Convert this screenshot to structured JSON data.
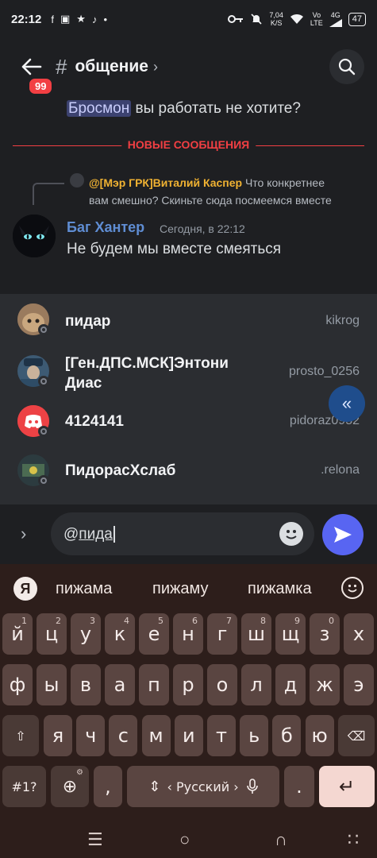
{
  "status_bar": {
    "time": "22:12",
    "left_icons": [
      "f",
      "▣",
      "★",
      "♪",
      "•"
    ],
    "speed_value": "7,04",
    "speed_unit": "K/S",
    "volte_top": "Vo",
    "volte_bottom": "LTE",
    "network": "4G",
    "battery": "47"
  },
  "header": {
    "unread_badge": "99",
    "hash": "#",
    "channel_name": "общение",
    "chevron": "›"
  },
  "chat": {
    "previous_message": {
      "mention": "Бросмон",
      "text": " вы работать не хотите?"
    },
    "new_messages_label": "НОВЫЕ СООБЩЕНИЯ",
    "reply": {
      "author": "@[Мэр ГРК]Виталий Каспер",
      "text": "Что  конкретнее вам смешно? Скиньте сюда посмеемся вместе"
    },
    "message": {
      "author": "Баг Хантер",
      "timestamp": "Сегодня, в 22:12",
      "text": "Не будем мы вместе смеяться"
    }
  },
  "mention_suggestions": [
    {
      "name": "пидар",
      "username": "kikrog"
    },
    {
      "name": "[Ген.ДПС.МСК]Энтони Диас",
      "username": "prosto_0256"
    },
    {
      "name": "4124141",
      "username": "pidoraz0952"
    },
    {
      "name": "ПидорасХслаб",
      "username": ".relona"
    }
  ],
  "jump_button_glyph": "«",
  "composer": {
    "expand_glyph": "›",
    "typed_prefix": "@",
    "typed_text": "пида"
  },
  "keyboard": {
    "brand_glyph": "Я",
    "suggestions": [
      "пижама",
      "пижаму",
      "пижамка"
    ],
    "row1": [
      {
        "c": "й",
        "h": "1"
      },
      {
        "c": "ц",
        "h": "2"
      },
      {
        "c": "у",
        "h": "3"
      },
      {
        "c": "к",
        "h": "4"
      },
      {
        "c": "е",
        "h": "5"
      },
      {
        "c": "н",
        "h": "6"
      },
      {
        "c": "г",
        "h": "7"
      },
      {
        "c": "ш",
        "h": "8"
      },
      {
        "c": "щ",
        "h": "9"
      },
      {
        "c": "з",
        "h": "0"
      },
      {
        "c": "х",
        "h": ""
      }
    ],
    "row2": [
      "ф",
      "ы",
      "в",
      "а",
      "п",
      "р",
      "о",
      "л",
      "д",
      "ж",
      "э"
    ],
    "row3": [
      "я",
      "ч",
      "с",
      "м",
      "и",
      "т",
      "ь",
      "б",
      "ю"
    ],
    "shift_glyph": "⇧",
    "backspace_glyph": "⌫",
    "symbols_label": "#1?",
    "globe_glyph": "⊕",
    "comma": ",",
    "space_label": "‹ Русский ›",
    "period": ".",
    "enter_glyph": "↵"
  },
  "navbar": {
    "recents": "☰",
    "home": "○",
    "back": "∩",
    "keyboard_toggle": "∷"
  },
  "colors": {
    "background": "#1e1f22",
    "panel": "#2b2d31",
    "accent": "#5865f2",
    "new_messages_red": "#f23f43",
    "reply_author_gold": "#f0b232",
    "message_author_blue": "#5f8dd3",
    "keyboard_bg": "#2d1e1b",
    "key_bg": "#5a4541"
  }
}
